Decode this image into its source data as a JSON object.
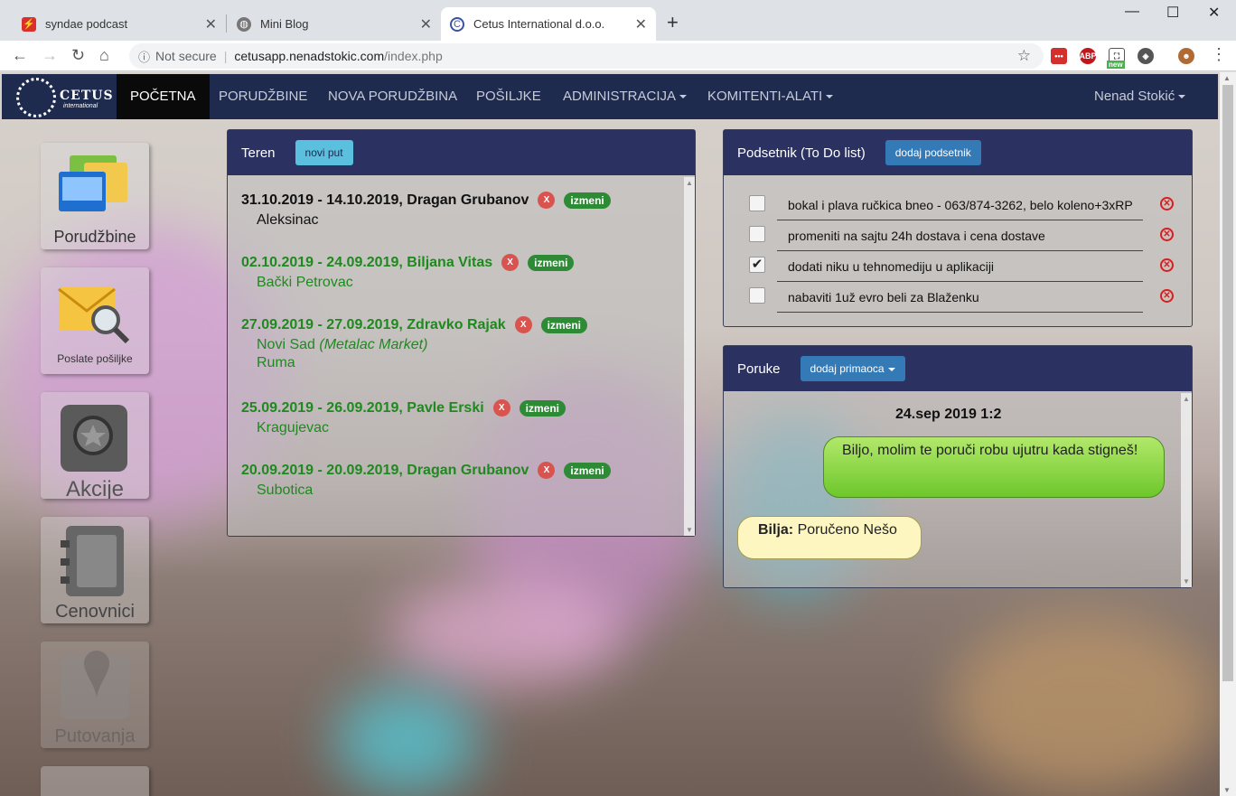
{
  "browser": {
    "tabs": [
      {
        "title": "syndae podcast",
        "active": false
      },
      {
        "title": "Mini Blog",
        "active": false
      },
      {
        "title": "Cetus International d.o.o.",
        "active": true
      }
    ],
    "security_label": "Not secure",
    "url_host": "cetusapp.nenadstokic.com",
    "url_path": "/index.php",
    "extension_new_badge": "new"
  },
  "nav": {
    "logo_text": "CETUS",
    "logo_sub": "international",
    "items": [
      "POČETNA",
      "PORUDŽBINE",
      "NOVA PORUDŽBINA",
      "POŠILJKE",
      "ADMINISTRACIJA",
      "KOMITENTI-ALATI"
    ],
    "user": "Nenad Stokić"
  },
  "sidebar": {
    "items": [
      {
        "label": "Porudžbine",
        "icon": "folders-icon"
      },
      {
        "label": "Poslate pošiljke",
        "icon": "envelope-search-icon"
      },
      {
        "label": "Akcije",
        "icon": "promo-tag-icon"
      },
      {
        "label": "Cenovnici",
        "icon": "notebook-icon"
      },
      {
        "label": "Putovanja",
        "icon": "map-pin-icon"
      }
    ]
  },
  "teren": {
    "title": "Teren",
    "button": "novi put",
    "delete_label": "X",
    "edit_label": "izmeni",
    "trips": [
      {
        "title": "31.10.2019 - 14.10.2019, Dragan Grubanov",
        "places": [
          "Aleksinac"
        ],
        "note": "",
        "color": "#111111"
      },
      {
        "title": "02.10.2019 - 24.09.2019, Biljana Vitas",
        "places": [
          "Bački Petrovac"
        ],
        "note": "",
        "color": "#1e8a1e"
      },
      {
        "title": "27.09.2019 - 27.09.2019, Zdravko Rajak",
        "places": [
          "Novi Sad",
          "Ruma"
        ],
        "note": "(Metalac Market)",
        "color": "#1e8a1e"
      },
      {
        "title": "25.09.2019 - 26.09.2019, Pavle Erski",
        "places": [
          "Kragujevac"
        ],
        "note": "",
        "color": "#1e8a1e"
      },
      {
        "title": "20.09.2019 - 20.09.2019, Dragan Grubanov",
        "places": [
          "Subotica"
        ],
        "note": "",
        "color": "#1e8a1e"
      }
    ]
  },
  "podsetnik": {
    "title": "Podsetnik (To Do list)",
    "button": "dodaj podsetnik",
    "items": [
      {
        "text": "bokal i plava ručkica bneo - 063/874-3262, belo koleno+3xRP",
        "checked": false
      },
      {
        "text": "promeniti na sajtu 24h dostava i cena dostave",
        "checked": false
      },
      {
        "text": "dodati niku u tehnomediju u aplikaciji",
        "checked": true
      },
      {
        "text": "nabaviti 1už evro beli za Blaženku",
        "checked": false
      }
    ]
  },
  "poruke": {
    "title": "Poruke",
    "button": "dodaj primaoca",
    "date": "24.sep 2019 1:2",
    "outgoing": "Biljo, molim te poruči robu ujutru kada stigneš!",
    "incoming_sender": "Bilja:",
    "incoming_text": "Poručeno Nešo"
  }
}
